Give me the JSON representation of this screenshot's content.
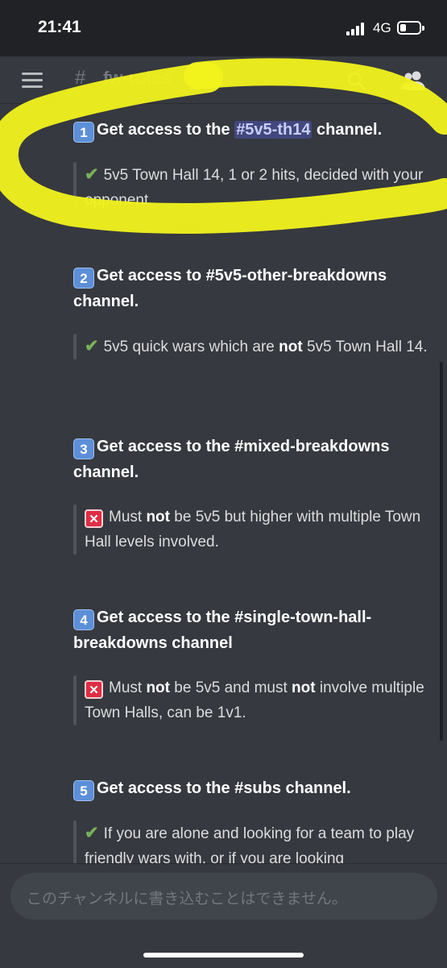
{
  "status_bar": {
    "time": "21:41",
    "network": "4G",
    "battery_level": 0.3
  },
  "header": {
    "channel_hash": "#",
    "channel_name": "fw-roles",
    "menu_icon": "hamburger-icon",
    "search_icon": "search-icon",
    "members_icon": "members-icon"
  },
  "sections": [
    {
      "num": "1",
      "h1": "Get access to the ",
      "mention": "#5v5-th14",
      "h2": " channel.",
      "emoji": "check",
      "q1": "5v5 Town Hall 14, 1 or 2 hits, decided with your opponent."
    },
    {
      "num": "2",
      "h1": "Get access to #5v5-other-breakdowns channel.",
      "emoji": "check",
      "q1": "5v5 quick wars which are ",
      "q_bold": "not",
      "q2": " 5v5 Town Hall 14."
    },
    {
      "num": "3",
      "h1": "Get access to the #mixed-breakdowns channel.",
      "emoji": "cross",
      "q1": "Must ",
      "q_bold": "not",
      "q2": " be 5v5 but higher with multiple Town Hall levels involved."
    },
    {
      "num": "4",
      "h1": "Get access to the #single-town-hall-breakdowns channel",
      "emoji": "cross",
      "q1": "Must ",
      "q_bold": "not",
      "q2": " be 5v5 and must ",
      "q_bold2": "not",
      "q3": " involve multiple Town Halls, can be 1v1."
    },
    {
      "num": "5",
      "h1": "Get access to the #subs channel.",
      "emoji": "check",
      "q1": "If you are alone and looking for a team to play friendly wars with, or if you are looking"
    }
  ],
  "footer": {
    "placeholder": "このチャンネルに書き込むことはできません。"
  },
  "colors": {
    "background": "#36393f",
    "status_bar": "#202225",
    "highlight": "#f2f21c",
    "mention_bg": "#4c5195",
    "check": "#78b159",
    "cross": "#dd2e44",
    "keycap": "#5d8fd8"
  }
}
